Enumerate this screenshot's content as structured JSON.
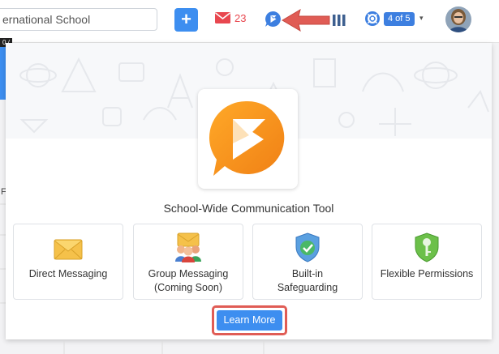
{
  "topbar": {
    "search_value": "ernational School",
    "add_label": "+",
    "mail_count": "23",
    "help_counter": "4 of 5",
    "caret": "▾"
  },
  "background": {
    "badge": "0 /",
    "letter": "F"
  },
  "card": {
    "title": "School-Wide Communication Tool",
    "features": [
      {
        "label": "Direct Messaging",
        "icon": "envelope-icon"
      },
      {
        "label": "Group Messaging\n(Coming Soon)",
        "icon": "group-messaging-icon"
      },
      {
        "label": "Built-in\nSafeguarding",
        "icon": "shield-check-icon"
      },
      {
        "label": "Flexible Permissions",
        "icon": "key-icon"
      }
    ],
    "learn_more": "Learn More"
  },
  "colors": {
    "accent": "#3d8ef0",
    "mail": "#e8474f",
    "highlight_arrow": "#e05c55",
    "logo_orange": "#f7941d"
  }
}
